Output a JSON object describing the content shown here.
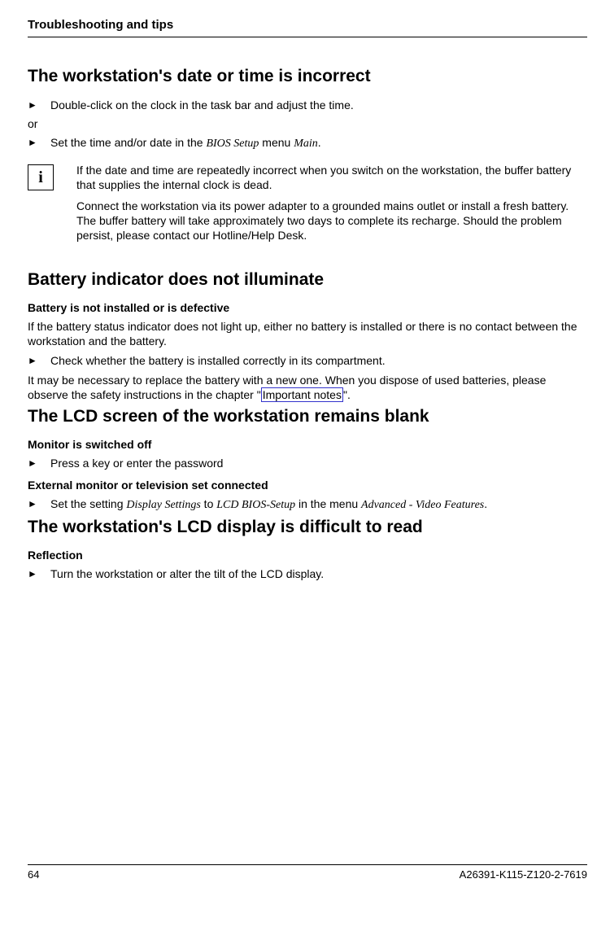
{
  "header": {
    "title": "Troubleshooting and tips"
  },
  "section1": {
    "heading": "The workstation's date or time is incorrect",
    "bullet1": "Double-click on the clock in the task bar and adjust the time.",
    "or": "or",
    "bullet2_pre": "Set the time and/or date in the ",
    "bullet2_ital1": "BIOS Setup",
    "bullet2_mid": " menu ",
    "bullet2_ital2": "Main",
    "bullet2_post": ".",
    "info_p1": "If the date and time are repeatedly incorrect when you switch on the workstation, the buffer battery that supplies the internal clock is dead.",
    "info_p2": "Connect the workstation via its power adapter to a grounded mains outlet or install a fresh battery. The buffer battery will take approximately two days to complete its recharge. Should the problem persist, please contact our Hotline/Help Desk.",
    "info_icon": "i"
  },
  "section2": {
    "heading": "Battery indicator does not illuminate",
    "sub1": "Battery is not installed or is defective",
    "p1": "If the battery status indicator does not light up, either no battery is installed or there is no contact between the workstation and the battery.",
    "bullet1": "Check whether the battery is installed correctly in its compartment.",
    "p2_pre": "It may be necessary to replace the battery with a new one. When you dispose of used batteries, please observe the safety instructions in the chapter \"",
    "p2_link": "Important notes",
    "p2_post": "\"."
  },
  "section3": {
    "heading": "The LCD screen of the workstation remains blank",
    "sub1": "Monitor is switched off",
    "bullet1": "Press a key or enter the password",
    "sub2": "External monitor or television set connected",
    "bullet2_pre": "Set the setting ",
    "bullet2_i1": "Display Settings",
    "bullet2_mid1": " to ",
    "bullet2_i2": "LCD BIOS-Setup",
    "bullet2_mid2": " in the menu ",
    "bullet2_i3": "Advanced - Video Features",
    "bullet2_post": "."
  },
  "section4": {
    "heading": "The workstation's LCD display is difficult to read",
    "sub1": "Reflection",
    "bullet1": "Turn the workstation or alter the tilt of the LCD display."
  },
  "footer": {
    "page": "64",
    "doc": "A26391-K115-Z120-2-7619"
  },
  "markers": {
    "triangle": "►"
  }
}
